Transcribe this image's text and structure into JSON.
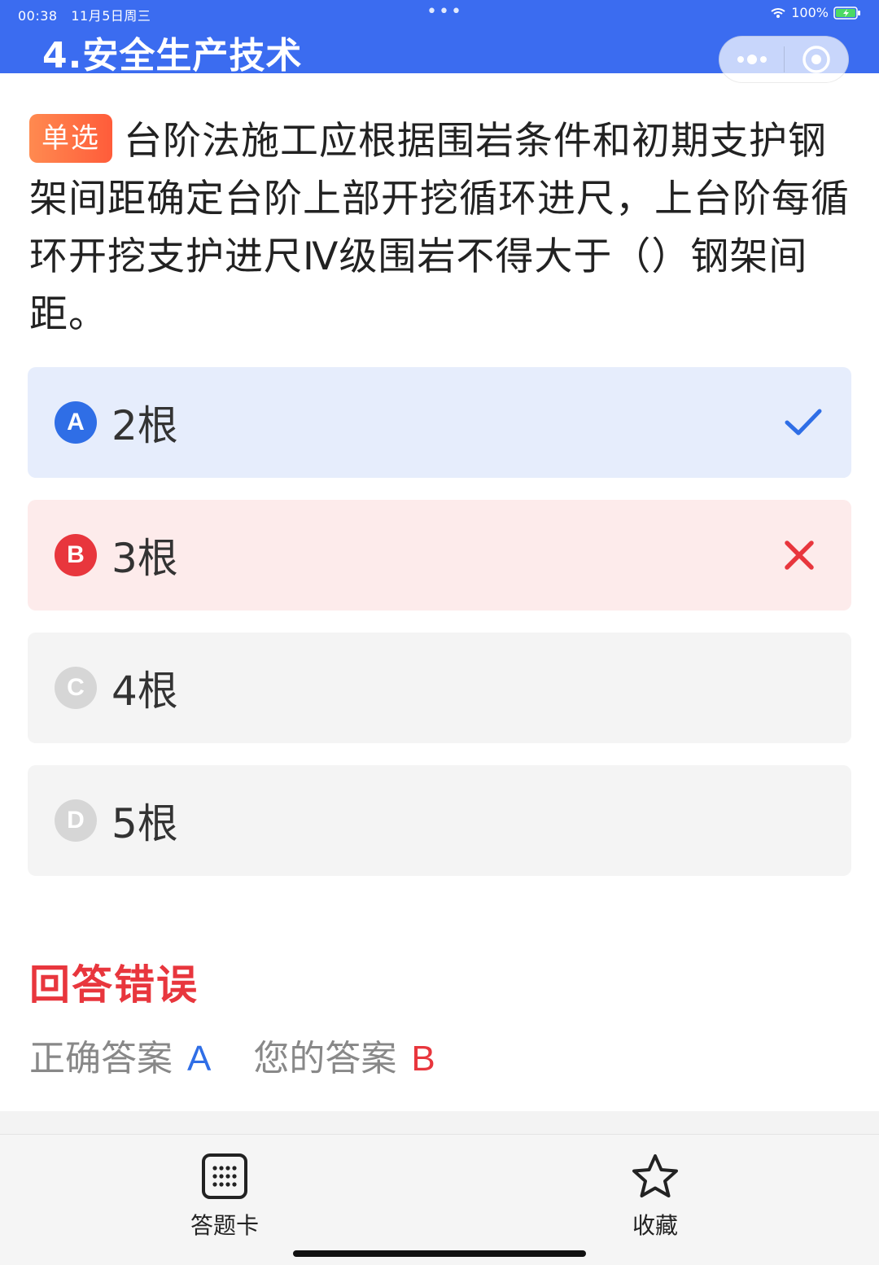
{
  "status_bar": {
    "time": "00:38",
    "date": "11月5日周三",
    "dots": "•••",
    "battery_percent": "100%",
    "icons": [
      "wifi-icon",
      "battery-charging-icon"
    ]
  },
  "nav": {
    "title": "4.安全生产技术",
    "capsule_icons": [
      "more-dots-icon",
      "close-target-icon"
    ]
  },
  "question": {
    "type_badge": "单选",
    "text": "台阶法施工应根据围岩条件和初期支护钢架间距确定台阶上部开挖循环进尺，上台阶每循环开挖支护进尺Ⅳ级围岩不得大于（）钢架间距。"
  },
  "options": [
    {
      "letter": "A",
      "text": "2根",
      "state": "correct",
      "mark_icon": "check-icon"
    },
    {
      "letter": "B",
      "text": "3根",
      "state": "wrong",
      "mark_icon": "cross-icon"
    },
    {
      "letter": "C",
      "text": "4根",
      "state": "neutral"
    },
    {
      "letter": "D",
      "text": "5根",
      "state": "neutral"
    }
  ],
  "result": {
    "title": "回答错误",
    "correct_label": "正确答案",
    "correct_value": "A",
    "yours_label": "您的答案",
    "yours_value": "B"
  },
  "bottom_bar": {
    "answer_card_label": "答题卡",
    "favorite_label": "收藏"
  },
  "colors": {
    "header_blue": "#3b6cf0",
    "correct_blue": "#2f6ee6",
    "wrong_red": "#e8363d",
    "badge_orange": "#ff6a3d"
  }
}
